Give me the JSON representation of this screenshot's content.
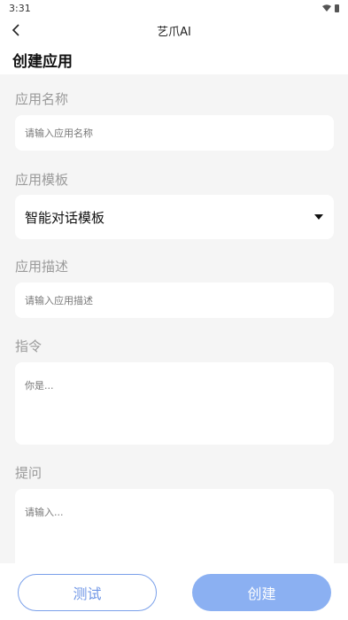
{
  "status_bar": {
    "time": "3:31"
  },
  "app_bar": {
    "title": "艺爪AI"
  },
  "page": {
    "section_title": "创建应用"
  },
  "form": {
    "name": {
      "label": "应用名称",
      "placeholder": "请输入应用名称"
    },
    "template": {
      "label": "应用模板",
      "selected": "智能对话模板"
    },
    "description": {
      "label": "应用描述",
      "placeholder": "请输入应用描述"
    },
    "instruction": {
      "label": "指令",
      "placeholder": "你是..."
    },
    "prompt": {
      "label": "提问",
      "placeholder": "请输入..."
    }
  },
  "actions": {
    "test_label": "测试",
    "create_label": "创建"
  },
  "colors": {
    "accent": "#8bb0f2",
    "outline": "#7aa0ea",
    "background": "#f5f5f5"
  }
}
